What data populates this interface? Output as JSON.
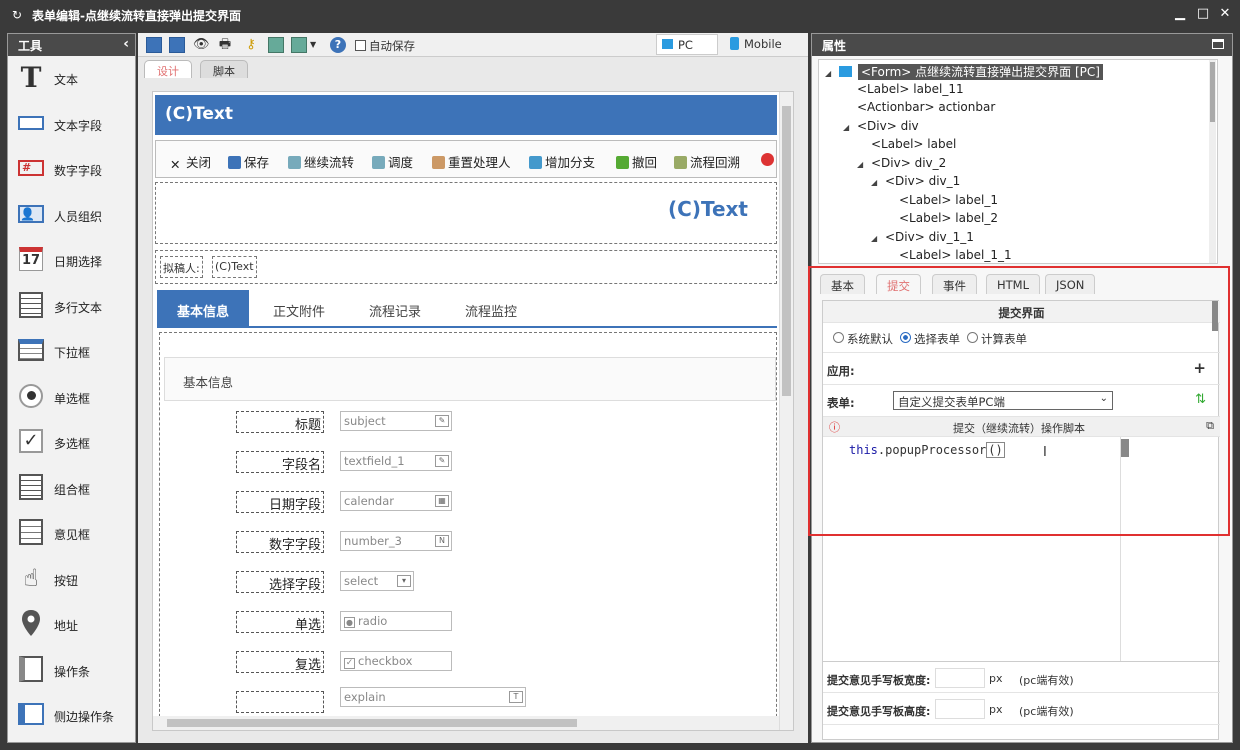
{
  "window": {
    "title": "表单编辑-点继续流转直接弹出提交界面"
  },
  "left": {
    "title": "工具",
    "tools": [
      {
        "label": "文本",
        "icon": "text-icon"
      },
      {
        "label": "文本字段",
        "icon": "textfield-icon"
      },
      {
        "label": "数字字段",
        "icon": "number-icon"
      },
      {
        "label": "人员组织",
        "icon": "person-icon"
      },
      {
        "label": "日期选择",
        "icon": "calendar-icon"
      },
      {
        "label": "多行文本",
        "icon": "textarea-icon"
      },
      {
        "label": "下拉框",
        "icon": "select-icon"
      },
      {
        "label": "单选框",
        "icon": "radio-icon"
      },
      {
        "label": "多选框",
        "icon": "checkbox-icon"
      },
      {
        "label": "组合框",
        "icon": "combo-icon"
      },
      {
        "label": "意见框",
        "icon": "opinion-icon"
      },
      {
        "label": "按钮",
        "icon": "button-icon"
      },
      {
        "label": "地址",
        "icon": "location-icon"
      },
      {
        "label": "操作条",
        "icon": "actionbar-icon"
      },
      {
        "label": "侧边操作条",
        "icon": "side-actionbar-icon"
      }
    ]
  },
  "toolbar": {
    "autosave": "自动保存",
    "pc": "PC",
    "mobile": "Mobile"
  },
  "design_tabs": [
    "设计",
    "脚本"
  ],
  "form": {
    "header": "(C)Text",
    "actions": [
      "关闭",
      "保存",
      "继续流转",
      "调度",
      "重置处理人",
      "增加分支",
      "撤回",
      "流程回溯"
    ],
    "title": "(C)Text",
    "drafter_label": "拟稿人:",
    "drafter_value": "(C)Text",
    "section_tabs": [
      "基本信息",
      "正文附件",
      "流程记录",
      "流程监控"
    ],
    "section_title": "基本信息",
    "rows": [
      {
        "label": "标题",
        "field": "subject"
      },
      {
        "label": "字段名",
        "field": "textfield_1"
      },
      {
        "label": "日期字段",
        "field": "calendar"
      },
      {
        "label": "数字字段",
        "field": "number_3"
      },
      {
        "label": "选择字段",
        "field": "select"
      },
      {
        "label": "单选",
        "field": "radio"
      },
      {
        "label": "复选",
        "field": "checkbox"
      },
      {
        "label": "",
        "field": "explain"
      }
    ]
  },
  "right": {
    "title": "属性",
    "tree": [
      "<Form> 点继续流转直接弹出提交界面 [PC]",
      "<Label> label_11",
      "<Actionbar> actionbar",
      "<Div> div",
      "<Label> label",
      "<Div> div_2",
      "<Div> div_1",
      "<Label> label_1",
      "<Label> label_2",
      "<Div> div_1_1",
      "<Label> label_1_1"
    ],
    "tabs": [
      "基本",
      "提交",
      "事件",
      "HTML",
      "JSON"
    ],
    "panel_title": "提交界面",
    "radio_options": [
      "系统默认",
      "选择表单",
      "计算表单"
    ],
    "app_label": "应用:",
    "form_label": "表单:",
    "form_select": "自定义提交表单PC端",
    "script_title": "提交（继续流转）操作脚本",
    "code_keyword": "this",
    "code_rest": ".popupProcessor",
    "code_parens": "()",
    "width_label": "提交意见手写板宽度:",
    "height_label": "提交意见手写板高度:",
    "px": "px",
    "pc_note": "(pc端有效)"
  }
}
